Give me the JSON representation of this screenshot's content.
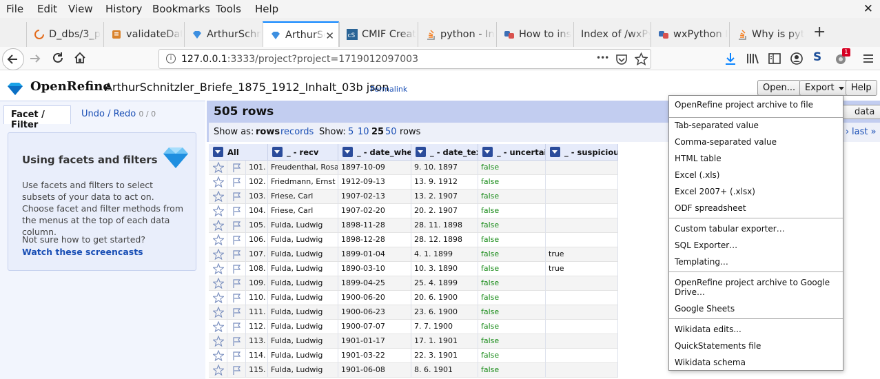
{
  "menubar": {
    "items": [
      {
        "label": "File"
      },
      {
        "label": "Edit"
      },
      {
        "label": "View"
      },
      {
        "label": "History"
      },
      {
        "label": "Bookmarks"
      },
      {
        "label": "Tools"
      },
      {
        "label": "Help"
      }
    ],
    "close": "✕"
  },
  "tabs": [
    {
      "label": "D_dbs/3_p",
      "icon": "loading-spinner-icon"
    },
    {
      "label": "validateDat",
      "icon": "document-icon"
    },
    {
      "label": "ArthurSchn",
      "icon": "openrefine-diamond-icon"
    },
    {
      "label": "ArthurSc",
      "icon": "openrefine-diamond-icon",
      "active": true
    },
    {
      "label": "CMIF Creat",
      "icon": "cs-icon"
    },
    {
      "label": "python - In",
      "icon": "stackoverflow-icon"
    },
    {
      "label": "How to ins",
      "icon": "python-icon"
    },
    {
      "label": "Index of /wxPy",
      "icon": "none"
    },
    {
      "label": "wxPython I",
      "icon": "python-icon"
    },
    {
      "label": "Why is pyt",
      "icon": "stackoverflow-icon"
    }
  ],
  "navbar": {
    "url_host": "127.0.0.1",
    "url_rest": ":3333/project?project=1719012097003",
    "more": "•••",
    "notification_count": "1"
  },
  "header": {
    "app_name": "OpenRefine",
    "project_title": "ArthurSchnitzler_Briefe_1875_1912_Inhalt_03b json",
    "permalink": "Permalink",
    "open_btn": "Open...",
    "export_btn": "Export",
    "help_btn": "Help",
    "wikidata_fragment": "data"
  },
  "leftpanel": {
    "tab_facet": "Facet / Filter",
    "tab_undo": "Undo / Redo",
    "undo_count": "0 / 0",
    "box_title": "Using facets and filters",
    "box_text": "Use facets and filters to select subsets of your data to act on. Choose facet and filter methods from the menus at the top of each data column.",
    "box_q": "Not sure how to get started?",
    "box_link": "Watch these screencasts"
  },
  "grid_header": {
    "rows_count": "505 rows",
    "show_as": "Show as:",
    "mode_rows": "rows",
    "mode_records": "records",
    "show": "Show:",
    "opt5": "5",
    "opt10": "10",
    "opt25": "25",
    "opt50": "50",
    "rows_word": "rows",
    "next_frag": "›",
    "last": "last »"
  },
  "columns": [
    "All",
    "_ - recv",
    "_ - date_when",
    "_ - date_text",
    "_ - uncertain",
    "_ - suspicious"
  ],
  "rows": [
    {
      "n": "101.",
      "recv": "Freudenthal, Rosa",
      "when": "1897-10-09",
      "text": "9. 10. 1897",
      "unc": "false",
      "sus": ""
    },
    {
      "n": "102.",
      "recv": "Friedmann, Ernst",
      "when": "1912-09-13",
      "text": "13. 9. 1912",
      "unc": "false",
      "sus": ""
    },
    {
      "n": "103.",
      "recv": "Friese, Carl",
      "when": "1907-02-13",
      "text": "13. 2. 1907",
      "unc": "false",
      "sus": ""
    },
    {
      "n": "104.",
      "recv": "Friese, Carl",
      "when": "1907-02-20",
      "text": "20. 2. 1907",
      "unc": "false",
      "sus": ""
    },
    {
      "n": "105.",
      "recv": "Fulda, Ludwig",
      "when": "1898-11-28",
      "text": "28. 11. 1898",
      "unc": "false",
      "sus": ""
    },
    {
      "n": "106.",
      "recv": "Fulda, Ludwig",
      "when": "1898-12-28",
      "text": "28. 12. 1898",
      "unc": "false",
      "sus": ""
    },
    {
      "n": "107.",
      "recv": "Fulda, Ludwig",
      "when": "1899-01-04",
      "text": "4. 1. 1899",
      "unc": "false",
      "sus": "true"
    },
    {
      "n": "108.",
      "recv": "Fulda, Ludwig",
      "when": "1890-03-10",
      "text": "10. 3. 1890",
      "unc": "false",
      "sus": "true"
    },
    {
      "n": "109.",
      "recv": "Fulda, Ludwig",
      "when": "1899-04-25",
      "text": "25. 4. 1899",
      "unc": "false",
      "sus": ""
    },
    {
      "n": "110.",
      "recv": "Fulda, Ludwig",
      "when": "1900-06-20",
      "text": "20. 6. 1900",
      "unc": "false",
      "sus": ""
    },
    {
      "n": "111.",
      "recv": "Fulda, Ludwig",
      "when": "1900-06-23",
      "text": "23. 6. 1900",
      "unc": "false",
      "sus": ""
    },
    {
      "n": "112.",
      "recv": "Fulda, Ludwig",
      "when": "1900-07-07",
      "text": "7. 7. 1900",
      "unc": "false",
      "sus": ""
    },
    {
      "n": "113.",
      "recv": "Fulda, Ludwig",
      "when": "1901-01-17",
      "text": "17. 1. 1901",
      "unc": "false",
      "sus": ""
    },
    {
      "n": "114.",
      "recv": "Fulda, Ludwig",
      "when": "1901-03-22",
      "text": "22. 3. 1901",
      "unc": "false",
      "sus": ""
    },
    {
      "n": "115.",
      "recv": "Fulda, Ludwig",
      "when": "1901-06-08",
      "text": "8. 6. 1901",
      "unc": "false",
      "sus": ""
    }
  ],
  "export_menu": {
    "items": [
      "OpenRefine project archive to file",
      "Tab-separated value",
      "Comma-separated value",
      "HTML table",
      "Excel (.xls)",
      "Excel 2007+ (.xlsx)",
      "ODF spreadsheet",
      "Custom tabular exporter…",
      "SQL Exporter…",
      "Templating…",
      "OpenRefine project archive to Google Drive…",
      "Google Sheets",
      "Wikidata edits...",
      "QuickStatements file",
      "Wikidata schema"
    ]
  },
  "colors": {
    "accent_blue": "#1a4fb5",
    "header_blue": "#c2cdf0",
    "false_green": "#1a8c1a",
    "tab_active": "#0a84ff"
  }
}
